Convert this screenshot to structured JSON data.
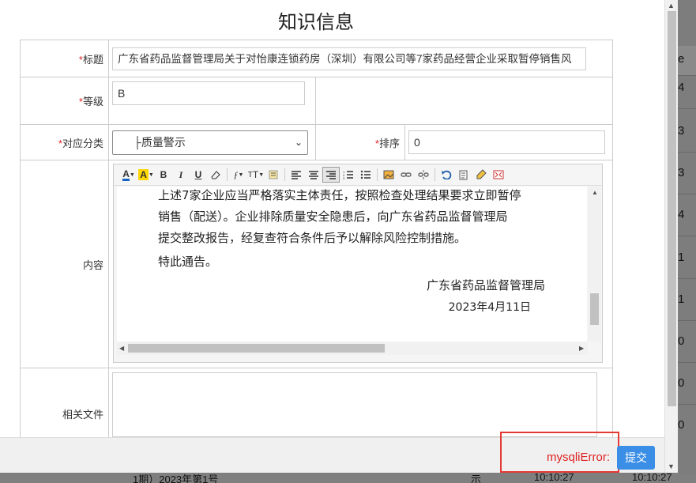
{
  "dialog": {
    "title": "知识信息"
  },
  "form": {
    "title_label": "标题",
    "title_value": "广东省药品监督管理局关于对怡康连锁药房（深圳）有限公司等7家药品经营企业采取暂停销售风",
    "level_label": "等级",
    "level_value": "B",
    "category_label": "对应分类",
    "category_value": "├质量警示",
    "sort_label": "排序",
    "sort_value": "0",
    "content_label": "内容",
    "files_label": "相关文件",
    "required_mark": "*"
  },
  "editor": {
    "toolbar": [
      "font-color-icon",
      "highlight-icon",
      "bold-icon",
      "italic-icon",
      "underline-icon",
      "eraser-icon",
      "font-family-icon",
      "font-size-icon",
      "paragraph-icon",
      "align-left-icon",
      "align-center-icon",
      "align-right-icon",
      "ordered-list-icon",
      "unordered-list-icon",
      "image-icon",
      "link-icon",
      "unlink-icon",
      "undo-icon",
      "paste-icon",
      "clear-format-icon",
      "fullscreen-icon"
    ],
    "paragraphs": [
      "上述7家企业应当严格落实主体责任，按照检查处理结果要求立即暂停",
      "销售（配送）。企业排除质量安全隐患后，向广东省药品监督管理局",
      "提交整改报告，经复查符合条件后予以解除风险控制措施。"
    ],
    "closing": "特此通告。",
    "signature": "广东省药品监督管理局",
    "date": "2023年4月11日"
  },
  "footer": {
    "error_text": "mysqliError:",
    "submit_label": "提交"
  },
  "background": {
    "col_head": "e",
    "cells": [
      "4",
      "3",
      "3",
      "4",
      "1",
      "1",
      "0",
      "0",
      "0"
    ],
    "bottom_text": "1期）2023年第1号",
    "bottom_mid": "示",
    "bottom_time1": "10:10:27",
    "bottom_time2": "10:10:27"
  }
}
